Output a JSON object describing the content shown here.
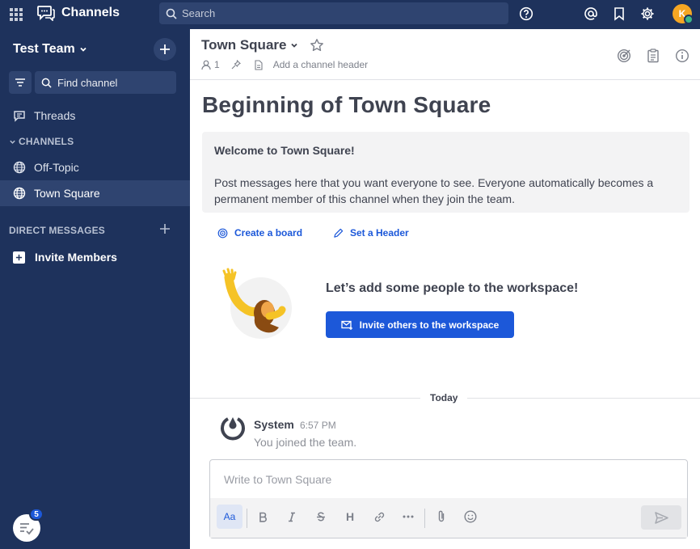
{
  "topbar": {
    "product_title": "Channels",
    "search_placeholder": "Search",
    "avatar_initial": "K"
  },
  "sidebar": {
    "team_name": "Test Team",
    "find_channel": "Find channel",
    "threads": "Threads",
    "channels_header": "CHANNELS",
    "channels": [
      {
        "label": "Off-Topic",
        "active": false
      },
      {
        "label": "Town Square",
        "active": true
      }
    ],
    "dm_header": "DIRECT MESSAGES",
    "invite_members": "Invite Members",
    "notification_count": "5"
  },
  "channel": {
    "name": "Town Square",
    "member_count": "1",
    "add_header": "Add a channel header",
    "intro_title": "Beginning of Town Square",
    "welcome_title": "Welcome to Town Square!",
    "welcome_body": "Post messages here that you want everyone to see. Everyone automatically becomes a permanent member of this channel when they join the team.",
    "create_board": "Create a board",
    "set_header": "Set a Header",
    "invite_heading": "Let’s add some people to the workspace!",
    "invite_button": "Invite others to the workspace"
  },
  "posts": {
    "day_label": "Today",
    "items": [
      {
        "author": "System",
        "time": "6:57 PM",
        "message": "You joined the team."
      }
    ]
  },
  "composer": {
    "placeholder": "Write to Town Square",
    "format_toggle": "Aa",
    "heading_btn": "H"
  },
  "colors": {
    "sidebar_bg": "#1e325c",
    "accent": "#1c58d9",
    "online": "#3db887",
    "avatar": "#f5a623"
  }
}
